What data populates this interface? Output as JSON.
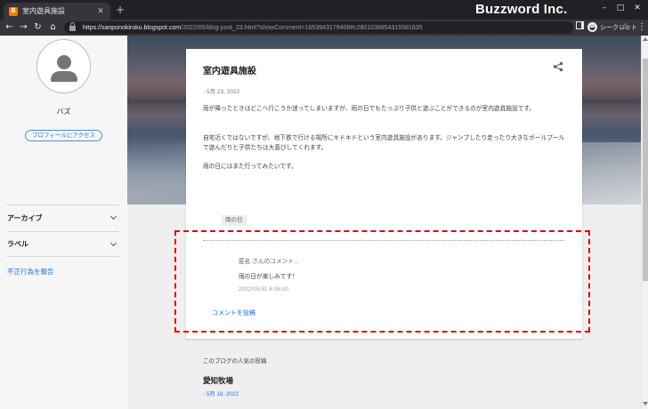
{
  "browser": {
    "tab_title": "室内遊具施設",
    "favicon_letter": "B",
    "close_glyph": "✕",
    "new_tab_glyph": "+",
    "brand": "Buzzword Inc.",
    "url_host": "https://sanponokiroku.blogspot.com",
    "url_path": "/2022/05/blog-post_23.html?showComment=1653943179408#c2801036854315581635",
    "profile_label": "シークレット",
    "win_min": "–",
    "win_max": "□",
    "win_close": "✕",
    "back_glyph": "←",
    "forward_glyph": "→",
    "reload_glyph": "↻",
    "home_glyph": "⌂",
    "star_glyph": "☆",
    "menu_glyph": "⋮",
    "icons": [
      "blogger-icon",
      "lock-icon",
      "star-icon",
      "sidepanel-icon",
      "incognito-icon",
      "menu-icon"
    ]
  },
  "sidebar": {
    "profile_name": "バズ",
    "profile_button": "プロフィールにアクセス",
    "items": [
      {
        "label": "アーカイブ"
      },
      {
        "label": "ラベル"
      }
    ],
    "report_link": "不正行為を報告"
  },
  "post": {
    "title": "室内遊具施設",
    "date": "- 5月 23, 2022",
    "paragraphs": [
      "雨が降ったときはどこへ行こうか迷ってしまいますが、雨の日でもたっぷり子供と遊ぶことができるのが室内遊具施設です。",
      "自宅近くではないですが、地下鉄で行ける場所にキドキドという室内遊具施設があります。ジャンプしたり走ったり大きなボールプールで遊んだりと子供たちは大喜びしてくれます。",
      "雨の日にはまた行ってみたいです。"
    ],
    "label_tag": "雨の日",
    "comment": {
      "author": "匿名 さんのコメント...",
      "text": "雨の日が楽しみです！",
      "timestamp": "2022/05/31 6:06:00"
    },
    "post_comment_link": "コメントを投稿"
  },
  "popular": {
    "heading": "このブログの人気の投稿",
    "title": "愛知牧場",
    "date": "- 5月 18, 2022"
  },
  "colors": {
    "highlight": "#e00000",
    "link": "#1a73e8",
    "chrome_dark": "#202124"
  }
}
